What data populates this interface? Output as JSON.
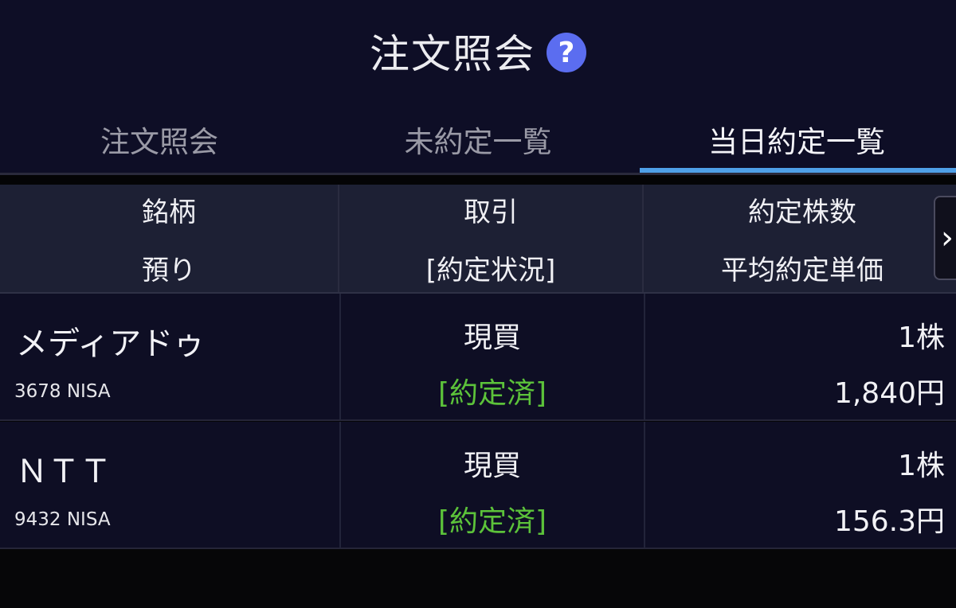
{
  "header": {
    "title": "注文照会",
    "help_icon": "?"
  },
  "tabs": [
    {
      "label": "注文照会",
      "active": false
    },
    {
      "label": "未約定一覧",
      "active": false
    },
    {
      "label": "当日約定一覧",
      "active": true
    }
  ],
  "columns": {
    "col1_top": "銘柄",
    "col1_bottom": "預り",
    "col2_top": "取引",
    "col2_bottom": "[約定状況]",
    "col3_top": "約定株数",
    "col3_bottom": "平均約定単価",
    "scroll_icon": "›"
  },
  "rows": [
    {
      "name": "メディアドゥ",
      "code": "3678 NISA",
      "trade": "現買",
      "status": "[約定済]",
      "quantity": "1株",
      "price": "1,840円"
    },
    {
      "name": "ＮＴＴ",
      "code": "9432 NISA",
      "trade": "現買",
      "status": "[約定済]",
      "quantity": "1株",
      "price": "156.3円"
    }
  ],
  "colors": {
    "accent": "#4fa0e8",
    "status_ok": "#5cc23a",
    "help_icon_bg": "#5b6df0"
  }
}
